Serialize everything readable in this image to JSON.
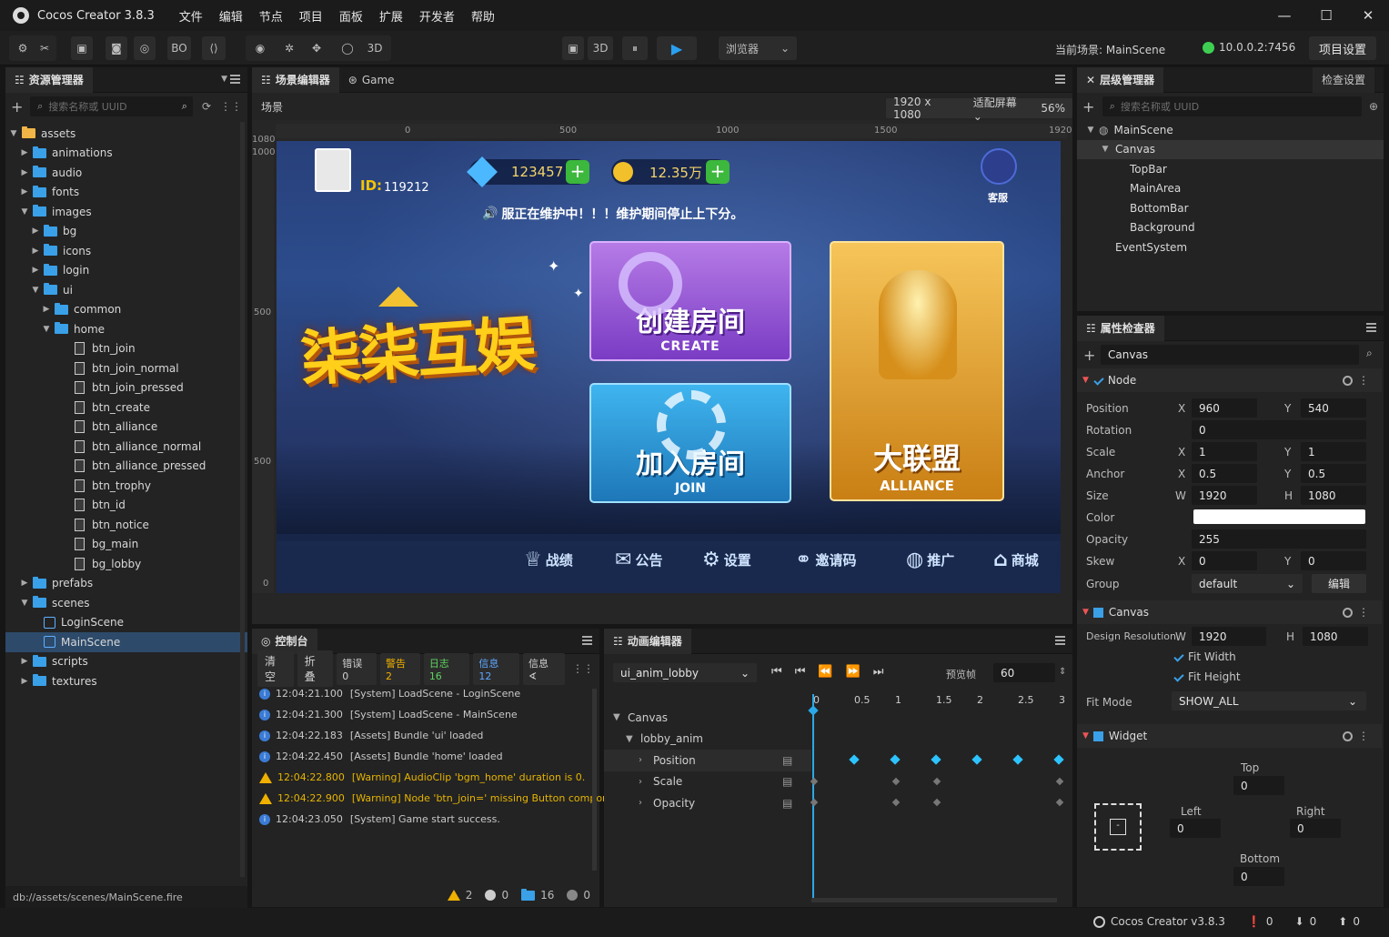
{
  "window": {
    "title": "Cocos Creator 3.8.3",
    "menu": [
      "文件",
      "编辑",
      "节点",
      "项目",
      "面板",
      "扩展",
      "开发者",
      "帮助"
    ]
  },
  "toolbar": {
    "bo_label": "BO",
    "mode_3d_label": "3D",
    "preview_3d_label": "3D",
    "preview_target": "浏览器",
    "current_scene": "当前场景: MainScene",
    "ip": "10.0.0.2:7456",
    "project_settings": "项目设置"
  },
  "assets": {
    "tab": "资源管理器",
    "search_placeholder": "搜索名称或 UUID",
    "items": [
      {
        "label": "assets",
        "depth": 0,
        "type": "folder-open",
        "arrow": "▼"
      },
      {
        "label": "animations",
        "depth": 1,
        "type": "folder",
        "arrow": "▶"
      },
      {
        "label": "audio",
        "depth": 1,
        "type": "folder",
        "arrow": "▶"
      },
      {
        "label": "fonts",
        "depth": 1,
        "type": "folder",
        "arrow": "▶"
      },
      {
        "label": "images",
        "depth": 1,
        "type": "folder",
        "arrow": "▼"
      },
      {
        "label": "bg",
        "depth": 2,
        "type": "folder",
        "arrow": "▶"
      },
      {
        "label": "icons",
        "depth": 2,
        "type": "folder",
        "arrow": "▶"
      },
      {
        "label": "login",
        "depth": 2,
        "type": "folder",
        "arrow": "▶"
      },
      {
        "label": "ui",
        "depth": 2,
        "type": "folder",
        "arrow": "▼"
      },
      {
        "label": "common",
        "depth": 3,
        "type": "folder",
        "arrow": "▶"
      },
      {
        "label": "home",
        "depth": 3,
        "type": "folder",
        "arrow": "▼"
      },
      {
        "label": "btn_join",
        "depth": 4,
        "type": "file",
        "arrow": ""
      },
      {
        "label": "btn_join_normal",
        "depth": 4,
        "type": "file",
        "arrow": ""
      },
      {
        "label": "btn_join_pressed",
        "depth": 4,
        "type": "file",
        "arrow": ""
      },
      {
        "label": "btn_create",
        "depth": 4,
        "type": "file",
        "arrow": ""
      },
      {
        "label": "btn_alliance",
        "depth": 4,
        "type": "file",
        "arrow": ""
      },
      {
        "label": "btn_alliance_normal",
        "depth": 4,
        "type": "file",
        "arrow": ""
      },
      {
        "label": "btn_alliance_pressed",
        "depth": 4,
        "type": "file",
        "arrow": ""
      },
      {
        "label": "btn_trophy",
        "depth": 4,
        "type": "file",
        "arrow": ""
      },
      {
        "label": "btn_id",
        "depth": 4,
        "type": "file",
        "arrow": ""
      },
      {
        "label": "btn_notice",
        "depth": 4,
        "type": "file",
        "arrow": ""
      },
      {
        "label": "bg_main",
        "depth": 4,
        "type": "file",
        "arrow": ""
      },
      {
        "label": "bg_lobby",
        "depth": 4,
        "type": "file",
        "arrow": ""
      },
      {
        "label": "prefabs",
        "depth": 1,
        "type": "folder",
        "arrow": "▶"
      },
      {
        "label": "scenes",
        "depth": 1,
        "type": "folder",
        "arrow": "▼"
      },
      {
        "label": "LoginScene",
        "depth": 2,
        "type": "scene",
        "arrow": ""
      },
      {
        "label": "MainScene",
        "depth": 2,
        "type": "scene",
        "arrow": "",
        "selected": true
      },
      {
        "label": "scripts",
        "depth": 1,
        "type": "folder",
        "arrow": "▶"
      },
      {
        "label": "textures",
        "depth": 1,
        "type": "folder",
        "arrow": "▶"
      }
    ],
    "footer_path": "db://assets/scenes/MainScene.fire"
  },
  "scene": {
    "tab_scene": "场景编辑器",
    "tab_game": "Game",
    "crumb": "场景",
    "resolution": "1920 x 1080",
    "fit": "适配屏幕",
    "zoom": "56%",
    "ruler_x": [
      "0",
      "500",
      "1000",
      "1500",
      "1920"
    ],
    "ruler_y": [
      "1080",
      "1000",
      "500",
      "500",
      "0"
    ]
  },
  "game": {
    "player_id_label": "ID:",
    "player_id": "119212",
    "diamonds": "123457",
    "gold": "12.35万",
    "service": "客服",
    "notice": "服正在维护中！！！维护期间停止上下分。",
    "logo": "柒柒互娱",
    "create_title": "创建房间",
    "create_sub": "CREATE",
    "join_title": "加入房间",
    "join_sub": "JOIN",
    "alliance_title": "大联盟",
    "alliance_sub": "ALLIANCE",
    "bottom": [
      "战绩",
      "公告",
      "设置",
      "邀请码",
      "推广",
      "商城"
    ]
  },
  "hierarchy": {
    "tab": "层级管理器",
    "tab2": "检查设置",
    "search_placeholder": "搜索名称或 UUID",
    "items": [
      {
        "label": "MainScene",
        "depth": 0,
        "arrow": "▼"
      },
      {
        "label": "Canvas",
        "depth": 1,
        "arrow": "▼",
        "selected": true
      },
      {
        "label": "TopBar",
        "depth": 2,
        "arrow": ""
      },
      {
        "label": "MainArea",
        "depth": 2,
        "arrow": ""
      },
      {
        "label": "BottomBar",
        "depth": 2,
        "arrow": ""
      },
      {
        "label": "Background",
        "depth": 2,
        "arrow": ""
      },
      {
        "label": "EventSystem",
        "depth": 1,
        "arrow": ""
      }
    ]
  },
  "inspector": {
    "tab": "属性检查器",
    "node_name": "Canvas",
    "node_section": "Node",
    "position": {
      "label": "Position",
      "x": "960",
      "y": "540"
    },
    "rotation": {
      "label": "Rotation",
      "v": "0"
    },
    "scale": {
      "label": "Scale",
      "x": "1",
      "y": "1"
    },
    "anchor": {
      "label": "Anchor",
      "x": "0.5",
      "y": "0.5"
    },
    "size": {
      "label": "Size",
      "w": "1920",
      "h": "1080"
    },
    "color": {
      "label": "Color",
      "value": "#ffffff"
    },
    "opacity": {
      "label": "Opacity",
      "v": "255"
    },
    "skew": {
      "label": "Skew",
      "x": "0",
      "y": "0"
    },
    "group": {
      "label": "Group",
      "v": "default",
      "edit": "编辑"
    },
    "canvas_section": "Canvas",
    "design_res": {
      "label": "Design Resolution",
      "w": "1920",
      "h": "1080"
    },
    "fit_width": "Fit Width",
    "fit_height": "Fit Height",
    "fit_mode": {
      "label": "Fit Mode",
      "v": "SHOW_ALL"
    },
    "widget_section": "Widget",
    "widget": {
      "top": "Top",
      "top_v": "0",
      "left": "Left",
      "left_v": "0",
      "right": "Right",
      "right_v": "0",
      "bottom": "Bottom",
      "bottom_v": "0"
    },
    "axis": {
      "x": "X",
      "y": "Y",
      "w": "W",
      "h": "H"
    }
  },
  "console": {
    "tab": "控制台",
    "buttons": [
      "清空",
      "折叠"
    ],
    "filters": [
      {
        "label": "错误 0",
        "color": "#d0d0d0"
      },
      {
        "label": "警告 2",
        "color": "#f0b000"
      },
      {
        "label": "日志 16",
        "color": "#5fd35f"
      },
      {
        "label": "信息 12",
        "color": "#5fa8ff"
      },
      {
        "label": "信息 ∢",
        "color": "#d0d0d0"
      }
    ],
    "lines": [
      {
        "level": "info",
        "time": "12:04:21.100",
        "text": "[System] LoadScene - LoginScene"
      },
      {
        "level": "info",
        "time": "12:04:21.300",
        "text": "[System] LoadScene - MainScene"
      },
      {
        "level": "info",
        "time": "12:04:22.183",
        "text": "[Assets] Bundle 'ui' loaded"
      },
      {
        "level": "info",
        "time": "12:04:22.450",
        "text": "[Assets] Bundle 'home' loaded"
      },
      {
        "level": "warn",
        "time": "12:04:22.800",
        "text": "[Warning] AudioClip 'bgm_home' duration is 0."
      },
      {
        "level": "warn",
        "time": "12:04:22.900",
        "text": "[Warning] Node 'btn_join=' missing Button component."
      },
      {
        "level": "info",
        "time": "12:04:23.050",
        "text": "[System] Game start success."
      }
    ],
    "footer": {
      "warn": "2",
      "error": "0",
      "log": "16",
      "info": "0"
    }
  },
  "animation": {
    "tab": "动画编辑器",
    "clip": "ui_anim_lobby",
    "sample_label": "预览帧",
    "sample": "60",
    "ticks": [
      "0",
      "0.5",
      "1",
      "1.5",
      "2",
      "2.5",
      "3"
    ],
    "tracks": [
      {
        "label": "Canvas",
        "depth": 0,
        "arrow": "▼"
      },
      {
        "label": "lobby_anim",
        "depth": 1,
        "arrow": "▼"
      },
      {
        "label": "Position",
        "depth": 2,
        "arrow": "›",
        "selected": true
      },
      {
        "label": "Scale",
        "depth": 2,
        "arrow": "›"
      },
      {
        "label": "Opacity",
        "depth": 2,
        "arrow": "›"
      }
    ]
  },
  "statusbar": {
    "version": "Cocos Creator v3.8.3",
    "a": "0",
    "b": "0",
    "c": "0"
  }
}
